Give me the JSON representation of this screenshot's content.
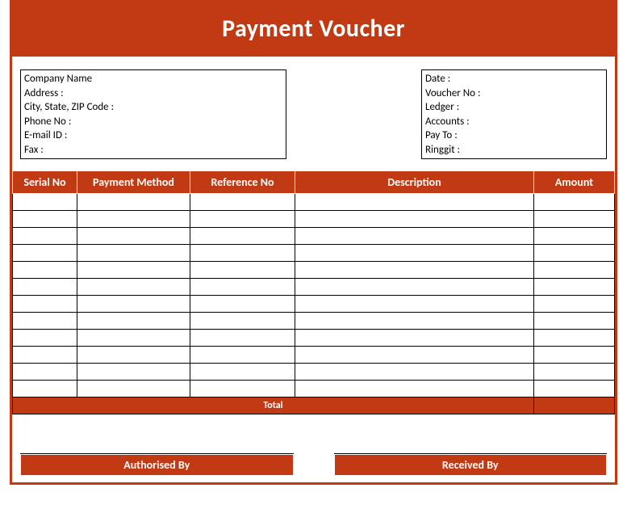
{
  "title": "Payment Voucher",
  "company_block": {
    "company": "Company Name",
    "address": "Address :",
    "csz": "City, State, ZIP Code :",
    "phone": "Phone No :",
    "email": "E-mail ID :",
    "fax": "Fax :"
  },
  "meta_block": {
    "date": "Date :",
    "voucher_no": "Voucher No :",
    "ledger": "Ledger :",
    "accounts": "Accounts :",
    "pay_to": "Pay To :",
    "ringgit": "Ringgit :"
  },
  "columns": {
    "serial": "Serial No",
    "method": "Payment Method",
    "ref": "Reference No",
    "desc": "Description",
    "amount": "Amount"
  },
  "rows": [
    {
      "serial": "",
      "method": "",
      "ref": "",
      "desc": "",
      "amount": ""
    },
    {
      "serial": "",
      "method": "",
      "ref": "",
      "desc": "",
      "amount": ""
    },
    {
      "serial": "",
      "method": "",
      "ref": "",
      "desc": "",
      "amount": ""
    },
    {
      "serial": "",
      "method": "",
      "ref": "",
      "desc": "",
      "amount": ""
    },
    {
      "serial": "",
      "method": "",
      "ref": "",
      "desc": "",
      "amount": ""
    },
    {
      "serial": "",
      "method": "",
      "ref": "",
      "desc": "",
      "amount": ""
    },
    {
      "serial": "",
      "method": "",
      "ref": "",
      "desc": "",
      "amount": ""
    },
    {
      "serial": "",
      "method": "",
      "ref": "",
      "desc": "",
      "amount": ""
    },
    {
      "serial": "",
      "method": "",
      "ref": "",
      "desc": "",
      "amount": ""
    },
    {
      "serial": "",
      "method": "",
      "ref": "",
      "desc": "",
      "amount": ""
    },
    {
      "serial": "",
      "method": "",
      "ref": "",
      "desc": "",
      "amount": ""
    },
    {
      "serial": "",
      "method": "",
      "ref": "",
      "desc": "",
      "amount": ""
    }
  ],
  "total_label": "Total",
  "total_value": "",
  "signatures": {
    "authorised": "Authorised By",
    "received": "Received By"
  }
}
